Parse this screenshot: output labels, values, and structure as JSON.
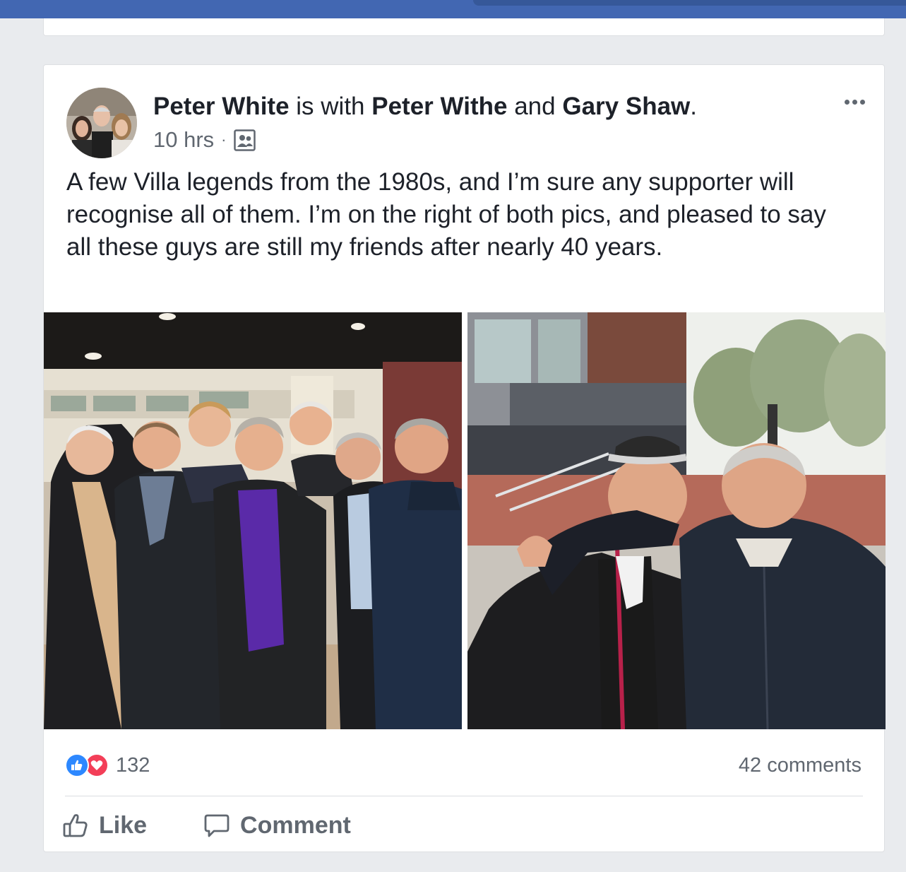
{
  "post": {
    "author": "Peter White",
    "with_text": " is with ",
    "tag1": "Peter Withe",
    "and_text": " and ",
    "tag2": "Gary Shaw",
    "period": ".",
    "time": "10 hrs",
    "separator": "·",
    "audience_icon": "friends-group-icon",
    "text": "A few Villa legends from the 1980s, and I’m sure any supporter will recognise all of them. I’m on the right of both pics, and pleased to say all these guys are still my friends after nearly 40 years."
  },
  "stats": {
    "reaction_count": "132",
    "comments": "42 comments",
    "reaction_icons": [
      "like-icon",
      "love-icon"
    ]
  },
  "actions": {
    "like": "Like",
    "comment": "Comment"
  },
  "colors": {
    "topbar": "#4267b2",
    "like_blue": "#2d88ff",
    "love_red": "#f33e58",
    "text": "#1d2129",
    "secondary": "#606770"
  }
}
